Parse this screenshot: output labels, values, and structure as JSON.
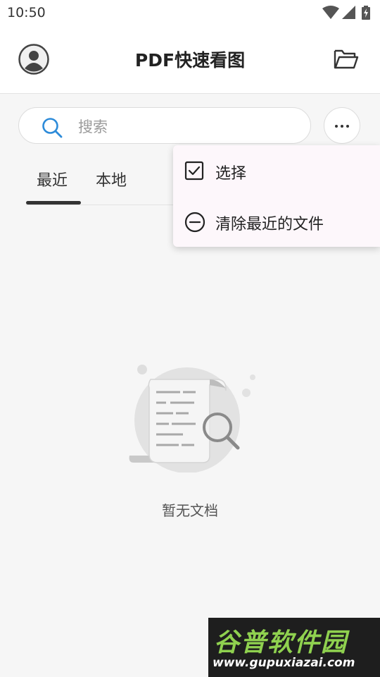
{
  "status_bar": {
    "time": "10:50"
  },
  "header": {
    "title": "PDF快速看图"
  },
  "search": {
    "placeholder": "搜索",
    "value": ""
  },
  "tabs": [
    {
      "label": "最近",
      "active": true
    },
    {
      "label": "本地",
      "active": false
    }
  ],
  "menu": {
    "items": [
      {
        "label": "选择",
        "icon": "checkbox-icon"
      },
      {
        "label": "清除最近的文件",
        "icon": "minus-circle-icon"
      }
    ]
  },
  "empty_state": {
    "text": "暂无文档"
  },
  "watermark": {
    "title": "谷普软件园",
    "url": "www.gupuxiazai.com"
  },
  "colors": {
    "accent_search": "#2d8bd9",
    "background": "#f6f6f6",
    "menu_bg": "#fdf7fb"
  }
}
